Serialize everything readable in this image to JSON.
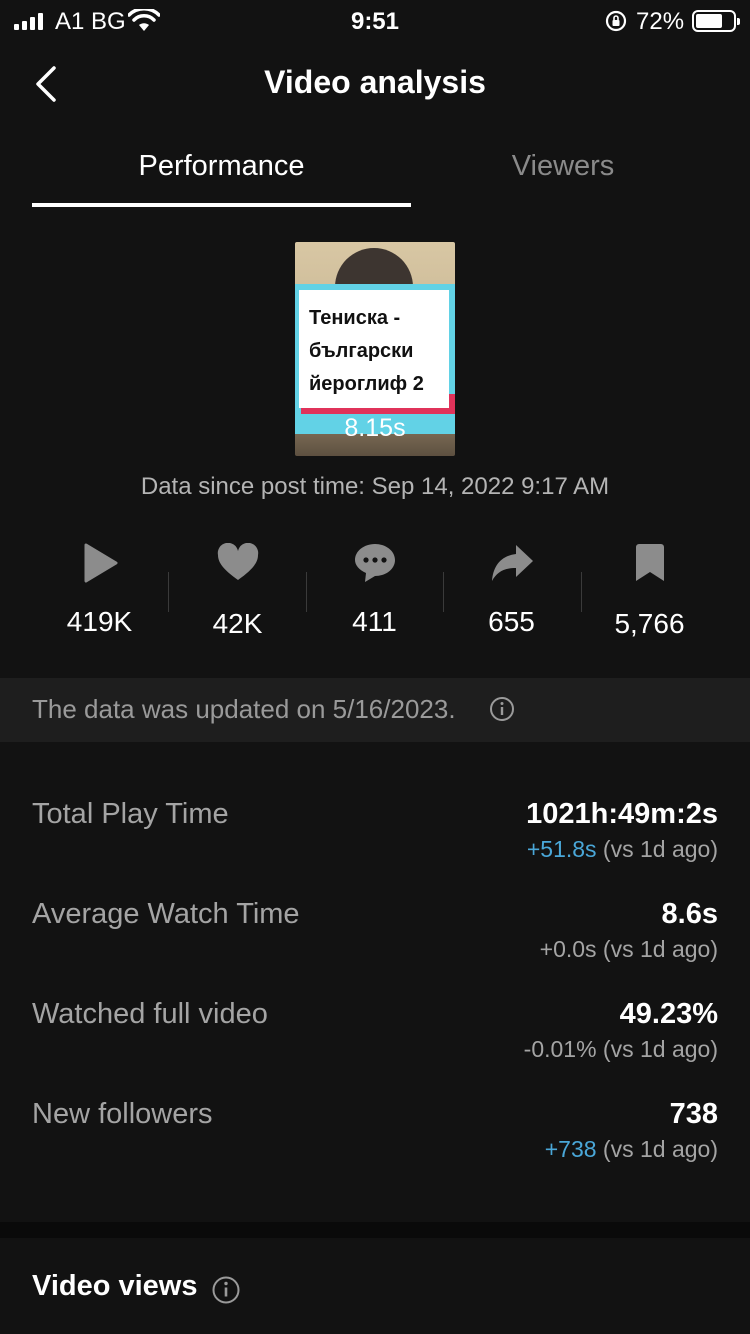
{
  "status_bar": {
    "carrier": "A1 BG",
    "time": "9:51",
    "battery": "72%",
    "battery_level": 0.72
  },
  "header": {
    "title": "Video analysis",
    "back_icon": "chevron-left-icon"
  },
  "tabs": [
    {
      "label": "Performance",
      "active": true
    },
    {
      "label": "Viewers",
      "active": false
    }
  ],
  "video": {
    "thumbnail_lines": [
      "Тениска -",
      "български",
      "йероглиф 2"
    ],
    "duration": "8.15s",
    "post_time": "Data since post time: Sep 14, 2022 9:17 AM"
  },
  "stats": [
    {
      "icon": "play-icon",
      "value": "419K"
    },
    {
      "icon": "heart-icon",
      "value": "42K"
    },
    {
      "icon": "comment-icon",
      "value": "411"
    },
    {
      "icon": "share-icon",
      "value": "655"
    },
    {
      "icon": "bookmark-icon",
      "value": "5,766"
    }
  ],
  "update_notice": "The data was updated on 5/16/2023.",
  "metrics": [
    {
      "label": "Total Play Time",
      "value": "1021h:49m:2s",
      "delta": "+51.8s",
      "delta_suffix": " (vs 1d ago)",
      "delta_color": "#4aa7d8"
    },
    {
      "label": "Average Watch Time",
      "value": "8.6s",
      "delta": "+0.0s",
      "delta_suffix": " (vs 1d ago)",
      "delta_color": "#a4a4a4"
    },
    {
      "label": "Watched full video",
      "value": "49.23%",
      "delta": "-0.01%",
      "delta_suffix": " (vs 1d ago)",
      "delta_color": "#a4a4a4"
    },
    {
      "label": "New followers",
      "value": "738",
      "delta": "+738",
      "delta_suffix": " (vs 1d ago)",
      "delta_color": "#4aa7d8"
    }
  ],
  "video_views_title": "Video views",
  "colors": {
    "background": "#121212",
    "accent_blue": "#4aa7d8",
    "muted_text": "#a4a4a4"
  }
}
